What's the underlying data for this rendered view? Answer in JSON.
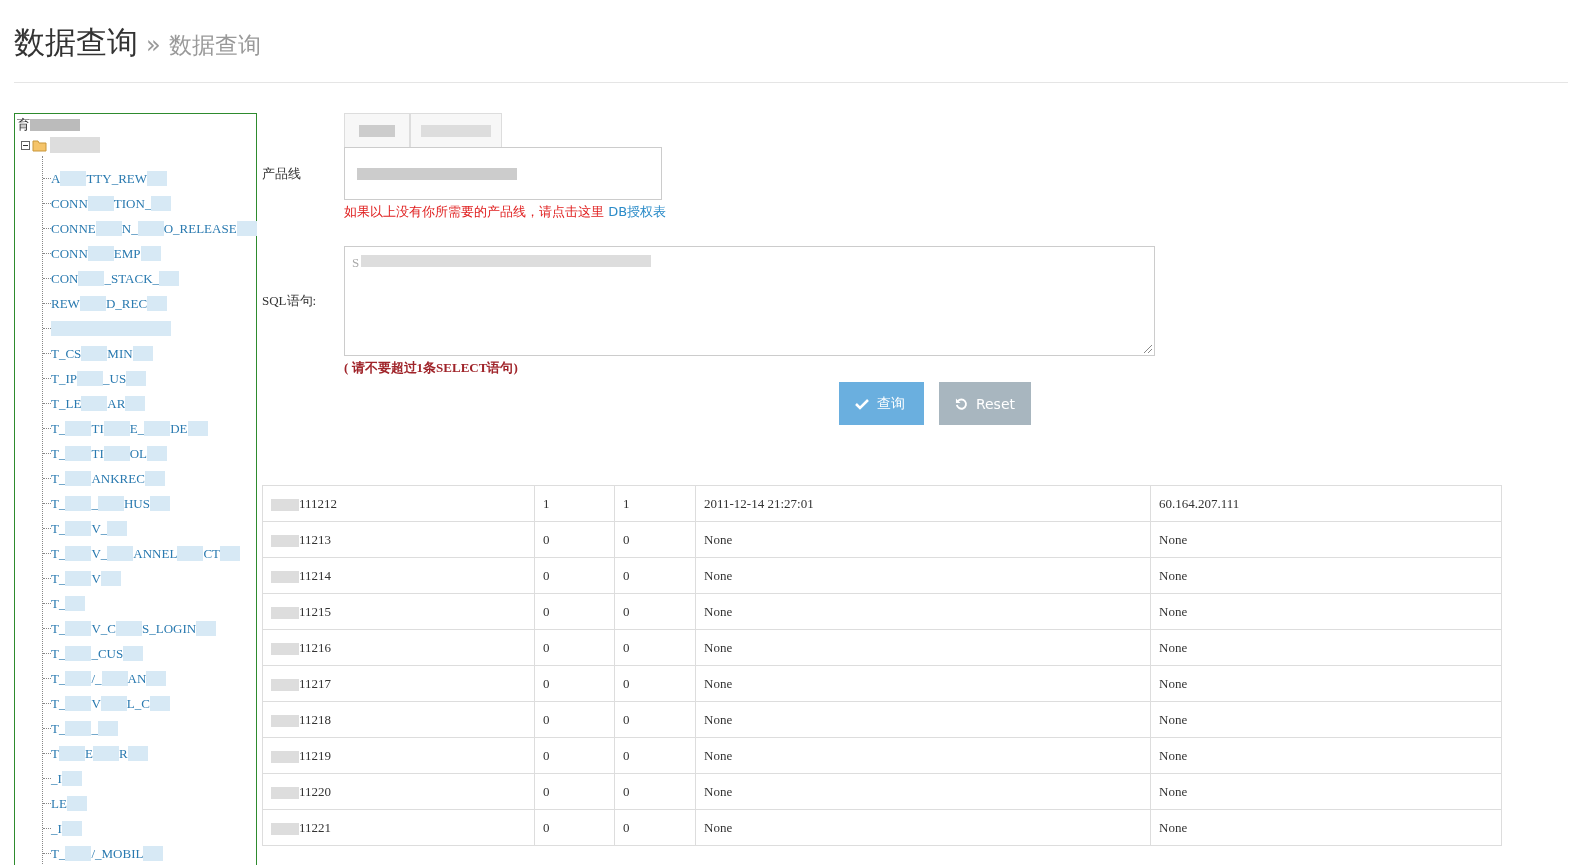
{
  "header": {
    "title": "数据查询",
    "separator": "»",
    "subtitle": "数据查询"
  },
  "tree": {
    "root": {
      "text": "育",
      "expanded": true,
      "children": [
        {
          "parts": [
            "A",
            "TTY_REW"
          ]
        },
        {
          "parts": [
            "CONN",
            "TION_"
          ]
        },
        {
          "parts": [
            "CONNE",
            "N_",
            "O_RELEASE"
          ]
        },
        {
          "parts": [
            "CONN",
            "EMP"
          ]
        },
        {
          "parts": [
            "CON",
            "_STACK_"
          ]
        },
        {
          "parts": [
            "REW",
            "D_REC"
          ]
        },
        {
          "kind": "redacted"
        },
        {
          "parts": [
            "T_CS",
            "MIN"
          ]
        },
        {
          "parts": [
            "T_IP",
            "_US"
          ]
        },
        {
          "parts": [
            "T_LE",
            "AR"
          ]
        },
        {
          "parts": [
            "T_",
            "TI",
            "E_",
            "DE"
          ]
        },
        {
          "parts": [
            "T_",
            "TI",
            "OL"
          ]
        },
        {
          "parts": [
            "T_",
            "ANKREC"
          ]
        },
        {
          "parts": [
            "T_",
            "_",
            "HUS"
          ]
        },
        {
          "parts": [
            "T_",
            "V_"
          ]
        },
        {
          "parts": [
            "T_",
            "V_",
            "ANNEL",
            "CT"
          ]
        },
        {
          "parts": [
            "T_",
            "V"
          ]
        },
        {
          "parts": [
            "T_"
          ]
        },
        {
          "parts": [
            "T_",
            "V_C",
            "S_LOGIN"
          ]
        },
        {
          "parts": [
            "T_",
            "_CUS"
          ]
        },
        {
          "parts": [
            "T_",
            "/_",
            "AN"
          ]
        },
        {
          "parts": [
            "T_",
            "V",
            "L_C"
          ]
        },
        {
          "parts": [
            "T_",
            "_"
          ]
        },
        {
          "parts": [
            "T",
            "E",
            "R"
          ]
        },
        {
          "parts": [
            "_I"
          ]
        },
        {
          "parts": [
            "LE"
          ]
        },
        {
          "parts": [
            "_I"
          ]
        },
        {
          "parts": [
            "T_",
            "/_MOBIL"
          ]
        }
      ]
    }
  },
  "form": {
    "product_label": "产品线",
    "hint": "如果以上没有你所需要的产品线，请点击这里",
    "hint_link": "DB授权表",
    "sql_label": "SQL语句:",
    "sql_value": "S",
    "sql_note": "( 请不要超过1条SELECT语句)",
    "buttons": [
      {
        "kind": "primary",
        "label": "查询"
      },
      {
        "kind": "reset",
        "label": "Reset"
      }
    ]
  },
  "table": {
    "rows": [
      [
        "111212",
        "1",
        "1",
        "2011-12-14 21:27:01",
        "60.164.207.111"
      ],
      [
        "11213",
        "0",
        "0",
        "None",
        "None"
      ],
      [
        "11214",
        "0",
        "0",
        "None",
        "None"
      ],
      [
        "11215",
        "0",
        "0",
        "None",
        "None"
      ],
      [
        "11216",
        "0",
        "0",
        "None",
        "None"
      ],
      [
        "11217",
        "0",
        "0",
        "None",
        "None"
      ],
      [
        "11218",
        "0",
        "0",
        "None",
        "None"
      ],
      [
        "11219",
        "0",
        "0",
        "None",
        "None"
      ],
      [
        "11220",
        "0",
        "0",
        "None",
        "None"
      ],
      [
        "11221",
        "0",
        "0",
        "None",
        "None"
      ]
    ]
  }
}
